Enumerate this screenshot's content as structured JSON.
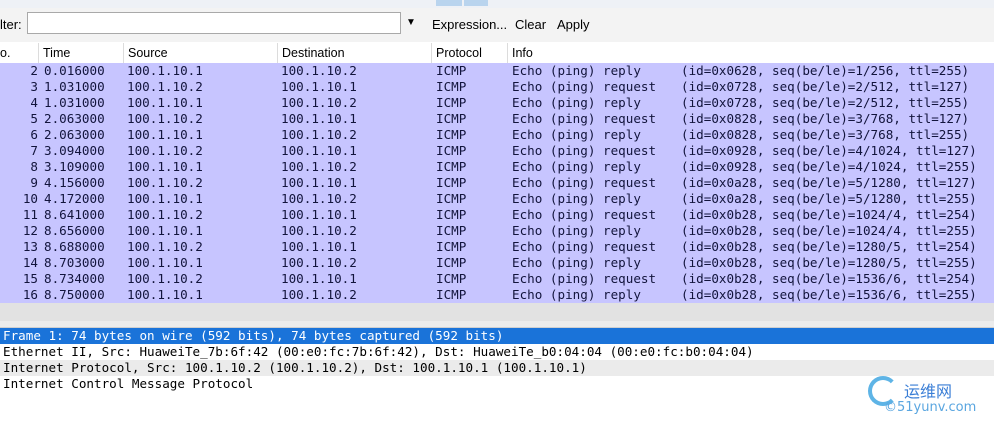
{
  "filter": {
    "label": "lter:",
    "value": "",
    "expression_label": "Expression...",
    "clear_label": "Clear",
    "apply_label": "Apply"
  },
  "columns": [
    "o.",
    "Time",
    "Source",
    "Destination",
    "Protocol",
    "Info"
  ],
  "packets": [
    {
      "no": "2",
      "time": "0.016000",
      "src": "100.1.10.1",
      "dst": "100.1.10.2",
      "proto": "ICMP",
      "info": "Echo (ping) reply",
      "detail": "(id=0x0628, seq(be/le)=1/256, ttl=255)"
    },
    {
      "no": "3",
      "time": "1.031000",
      "src": "100.1.10.2",
      "dst": "100.1.10.1",
      "proto": "ICMP",
      "info": "Echo (ping) request",
      "detail": "(id=0x0728, seq(be/le)=2/512, ttl=127)"
    },
    {
      "no": "4",
      "time": "1.031000",
      "src": "100.1.10.1",
      "dst": "100.1.10.2",
      "proto": "ICMP",
      "info": "Echo (ping) reply",
      "detail": "(id=0x0728, seq(be/le)=2/512, ttl=255)"
    },
    {
      "no": "5",
      "time": "2.063000",
      "src": "100.1.10.2",
      "dst": "100.1.10.1",
      "proto": "ICMP",
      "info": "Echo (ping) request",
      "detail": "(id=0x0828, seq(be/le)=3/768, ttl=127)"
    },
    {
      "no": "6",
      "time": "2.063000",
      "src": "100.1.10.1",
      "dst": "100.1.10.2",
      "proto": "ICMP",
      "info": "Echo (ping) reply",
      "detail": "(id=0x0828, seq(be/le)=3/768, ttl=255)"
    },
    {
      "no": "7",
      "time": "3.094000",
      "src": "100.1.10.2",
      "dst": "100.1.10.1",
      "proto": "ICMP",
      "info": "Echo (ping) request",
      "detail": "(id=0x0928, seq(be/le)=4/1024, ttl=127)"
    },
    {
      "no": "8",
      "time": "3.109000",
      "src": "100.1.10.1",
      "dst": "100.1.10.2",
      "proto": "ICMP",
      "info": "Echo (ping) reply",
      "detail": "(id=0x0928, seq(be/le)=4/1024, ttl=255)"
    },
    {
      "no": "9",
      "time": "4.156000",
      "src": "100.1.10.2",
      "dst": "100.1.10.1",
      "proto": "ICMP",
      "info": "Echo (ping) request",
      "detail": "(id=0x0a28, seq(be/le)=5/1280, ttl=127)"
    },
    {
      "no": "10",
      "time": "4.172000",
      "src": "100.1.10.1",
      "dst": "100.1.10.2",
      "proto": "ICMP",
      "info": "Echo (ping) reply",
      "detail": "(id=0x0a28, seq(be/le)=5/1280, ttl=255)"
    },
    {
      "no": "11",
      "time": "8.641000",
      "src": "100.1.10.2",
      "dst": "100.1.10.1",
      "proto": "ICMP",
      "info": "Echo (ping) request",
      "detail": "(id=0x0b28, seq(be/le)=1024/4, ttl=254)"
    },
    {
      "no": "12",
      "time": "8.656000",
      "src": "100.1.10.1",
      "dst": "100.1.10.2",
      "proto": "ICMP",
      "info": "Echo (ping) reply",
      "detail": "(id=0x0b28, seq(be/le)=1024/4, ttl=255)"
    },
    {
      "no": "13",
      "time": "8.688000",
      "src": "100.1.10.2",
      "dst": "100.1.10.1",
      "proto": "ICMP",
      "info": "Echo (ping) request",
      "detail": "(id=0x0b28, seq(be/le)=1280/5, ttl=254)"
    },
    {
      "no": "14",
      "time": "8.703000",
      "src": "100.1.10.1",
      "dst": "100.1.10.2",
      "proto": "ICMP",
      "info": "Echo (ping) reply",
      "detail": "(id=0x0b28, seq(be/le)=1280/5, ttl=255)"
    },
    {
      "no": "15",
      "time": "8.734000",
      "src": "100.1.10.2",
      "dst": "100.1.10.1",
      "proto": "ICMP",
      "info": "Echo (ping) request",
      "detail": "(id=0x0b28, seq(be/le)=1536/6, ttl=254)"
    },
    {
      "no": "16",
      "time": "8.750000",
      "src": "100.1.10.1",
      "dst": "100.1.10.2",
      "proto": "ICMP",
      "info": "Echo (ping) reply",
      "detail": "(id=0x0b28, seq(be/le)=1536/6, ttl=255)"
    }
  ],
  "details": [
    "Frame 1: 74 bytes on wire (592 bits), 74 bytes captured (592 bits)",
    "Ethernet II, Src: HuaweiTe_7b:6f:42 (00:e0:fc:7b:6f:42), Dst: HuaweiTe_b0:04:04 (00:e0:fc:b0:04:04)",
    "Internet Protocol, Src: 100.1.10.2 (100.1.10.2), Dst: 100.1.10.1 (100.1.10.1)",
    "Internet Control Message Protocol"
  ],
  "watermark": {
    "line1": "运维网",
    "line2": "©51yunv.com"
  },
  "colors": {
    "row_bg": "#c7c5ff",
    "selected_bg": "#1a73d9"
  }
}
